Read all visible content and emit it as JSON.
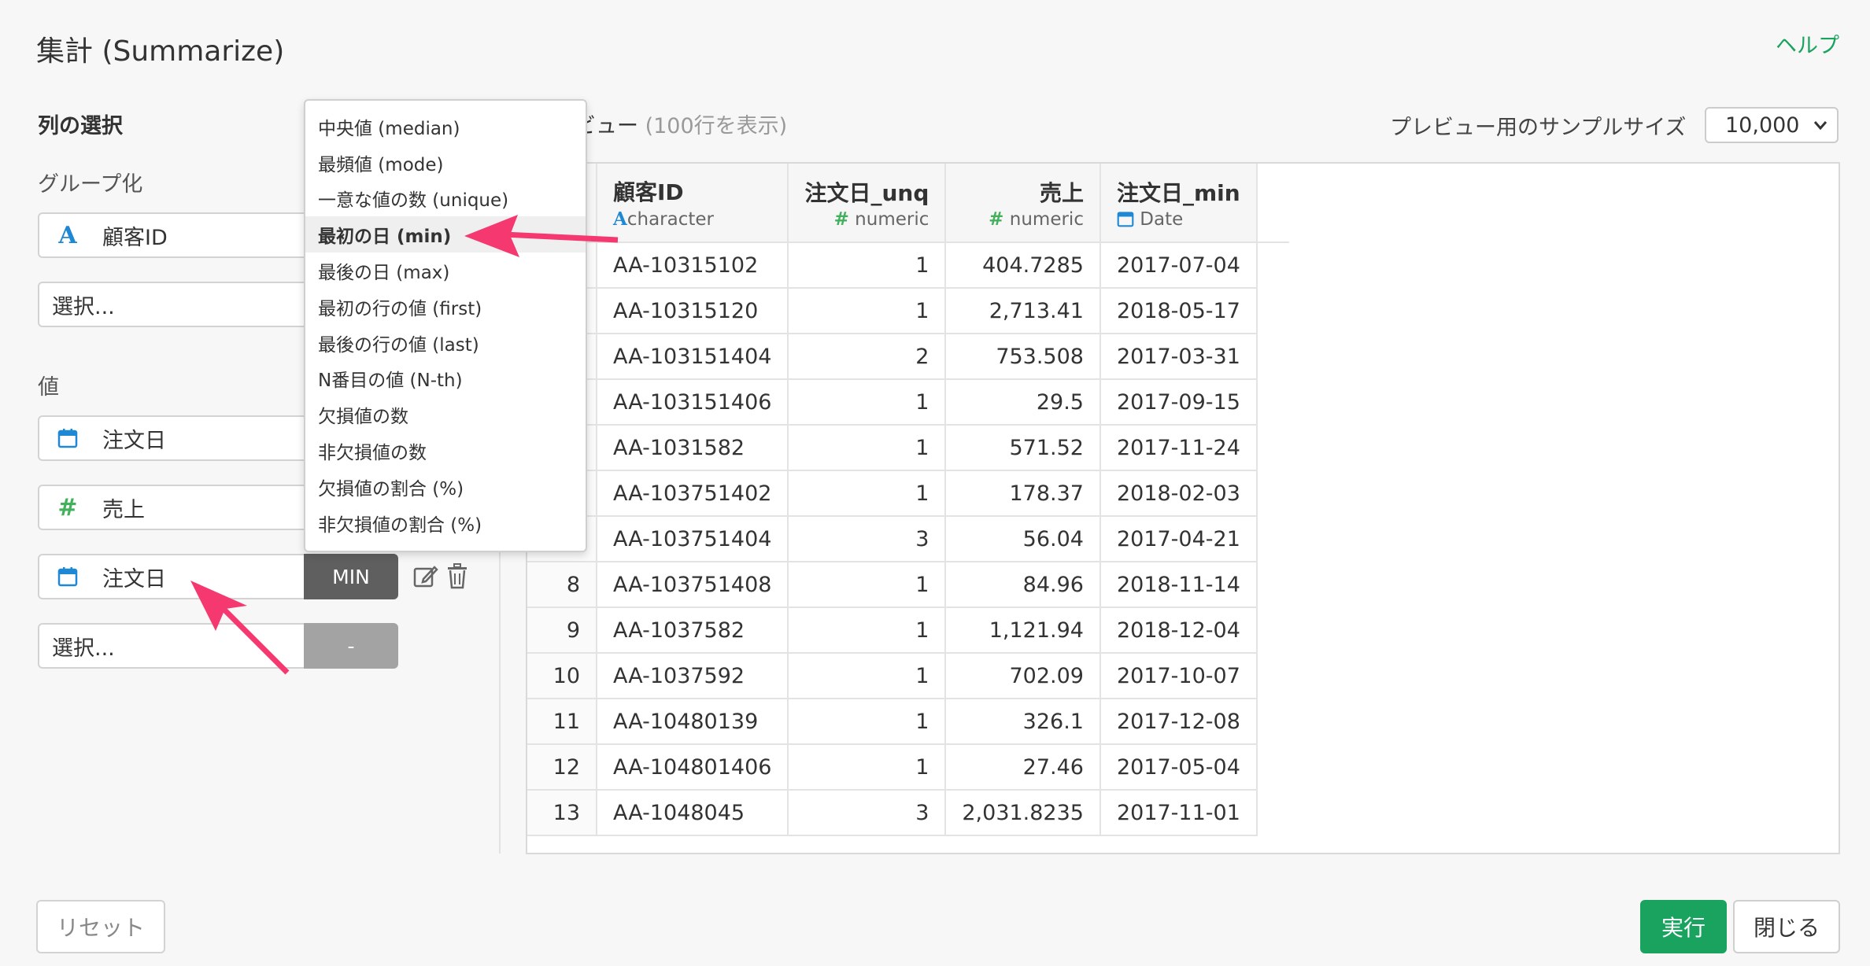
{
  "header": {
    "title": "集計 (Summarize)",
    "help": "ヘルプ"
  },
  "left": {
    "section_title": "列の選択",
    "group_label": "グループ化",
    "group_fields": [
      {
        "icon": "character-a-icon",
        "label": "顧客ID"
      },
      {
        "placeholder": "選択..."
      }
    ],
    "value_label": "値",
    "value_fields": [
      {
        "icon": "calendar-icon",
        "label": "注文日"
      },
      {
        "icon": "hash-icon",
        "label": "売上"
      },
      {
        "icon": "calendar-icon",
        "label": "注文日",
        "agg": "MIN"
      },
      {
        "placeholder": "選択...",
        "agg": "-"
      }
    ]
  },
  "preview": {
    "title": "ビュー",
    "subtitle": "(100行を表示)",
    "sample_label": "プレビュー用のサンプルサイズ",
    "sample_value": "10,000"
  },
  "table": {
    "columns": [
      {
        "name": "顧客ID",
        "type": "character"
      },
      {
        "name": "注文日_unq",
        "type": "numeric"
      },
      {
        "name": "売上",
        "type": "numeric"
      },
      {
        "name": "注文日_min",
        "type": "Date"
      }
    ],
    "rows": [
      {
        "n": "",
        "id": "AA-10315102",
        "unq": "1",
        "sales": "404.7285",
        "date": "2017-07-04"
      },
      {
        "n": "",
        "id": "AA-10315120",
        "unq": "1",
        "sales": "2,713.41",
        "date": "2018-05-17"
      },
      {
        "n": "",
        "id": "AA-103151404",
        "unq": "2",
        "sales": "753.508",
        "date": "2017-03-31"
      },
      {
        "n": "",
        "id": "AA-103151406",
        "unq": "1",
        "sales": "29.5",
        "date": "2017-09-15"
      },
      {
        "n": "",
        "id": "AA-1031582",
        "unq": "1",
        "sales": "571.52",
        "date": "2017-11-24"
      },
      {
        "n": "",
        "id": "AA-103751402",
        "unq": "1",
        "sales": "178.37",
        "date": "2018-02-03"
      },
      {
        "n": "",
        "id": "AA-103751404",
        "unq": "3",
        "sales": "56.04",
        "date": "2017-04-21"
      },
      {
        "n": "8",
        "id": "AA-103751408",
        "unq": "1",
        "sales": "84.96",
        "date": "2018-11-14"
      },
      {
        "n": "9",
        "id": "AA-1037582",
        "unq": "1",
        "sales": "1,121.94",
        "date": "2018-12-04"
      },
      {
        "n": "10",
        "id": "AA-1037592",
        "unq": "1",
        "sales": "702.09",
        "date": "2017-10-07"
      },
      {
        "n": "11",
        "id": "AA-10480139",
        "unq": "1",
        "sales": "326.1",
        "date": "2017-12-08"
      },
      {
        "n": "12",
        "id": "AA-104801406",
        "unq": "1",
        "sales": "27.46",
        "date": "2017-05-04"
      },
      {
        "n": "13",
        "id": "AA-1048045",
        "unq": "3",
        "sales": "2,031.8235",
        "date": "2017-11-01"
      }
    ]
  },
  "agg_menu": {
    "items": [
      "中央値 (median)",
      "最頻値 (mode)",
      "一意な値の数 (unique)",
      "最初の日 (min)",
      "最後の日 (max)",
      "最初の行の値 (first)",
      "最後の行の値 (last)",
      "N番目の値 (N-th)",
      "欠損値の数",
      "非欠損値の数",
      "欠損値の割合 (%)",
      "非欠損値の割合 (%)"
    ],
    "active_index": 3
  },
  "footer": {
    "reset": "リセット",
    "run": "実行",
    "close": "閉じる"
  },
  "colors": {
    "accent": "#19a35f",
    "arrow": "#f5386f",
    "char_icon": "#1e88d4",
    "num_icon": "#43b05c"
  }
}
